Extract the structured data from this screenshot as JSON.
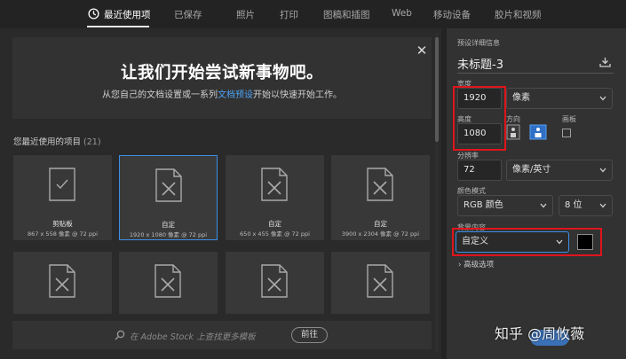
{
  "tabs": [
    {
      "label": "最近使用项",
      "active": true
    },
    {
      "label": "已保存"
    },
    {
      "label": "照片"
    },
    {
      "label": "打印"
    },
    {
      "label": "图稿和插图"
    },
    {
      "label": "Web"
    },
    {
      "label": "移动设备"
    },
    {
      "label": "胶片和视频"
    }
  ],
  "welcome": {
    "title": "让我们开始尝试新事物吧。",
    "subtitle_before": "从您自己的文档设置或一系列",
    "subtitle_link": "文档预设",
    "subtitle_after": "开始以快速开始工作。"
  },
  "recent": {
    "label": "您最近使用的项目",
    "count": "(21)",
    "items": [
      {
        "name": "剪贴板",
        "size": "867 x 558 像素 @ 72 ppi",
        "icon": "clipboard-doc-icon"
      },
      {
        "name": "自定",
        "size": "1920 x 1080 像素 @ 72 ppi",
        "icon": "custom-doc-icon",
        "selected": true
      },
      {
        "name": "自定",
        "size": "650 x 455 像素 @ 72 ppi",
        "icon": "custom-doc-icon"
      },
      {
        "name": "自定",
        "size": "3900 x 2304 像素 @ 72 ppi",
        "icon": "custom-doc-icon"
      }
    ]
  },
  "search": {
    "placeholder": "在 Adobe Stock 上查找更多模板",
    "go_label": "前往"
  },
  "preset": {
    "section_label": "预设详细信息",
    "doc_name": "未标题-3",
    "width_label": "宽度",
    "width_value": "1920",
    "unit": "像素",
    "height_label": "高度",
    "height_value": "1080",
    "orientation_label": "方向",
    "artboard_label": "画板",
    "resolution_label": "分辨率",
    "resolution_value": "72",
    "resolution_unit": "像素/英寸",
    "color_mode_label": "颜色模式",
    "color_mode": "RGB 颜色",
    "bit_depth": "8 位",
    "background_label": "背景内容",
    "background_value": "自定义",
    "background_color": "#000000",
    "advanced_label": "高级选项"
  },
  "watermark": "知乎 @周攸薇",
  "colors": {
    "accent": "#3b8ee6",
    "highlight": "#e0141c"
  }
}
